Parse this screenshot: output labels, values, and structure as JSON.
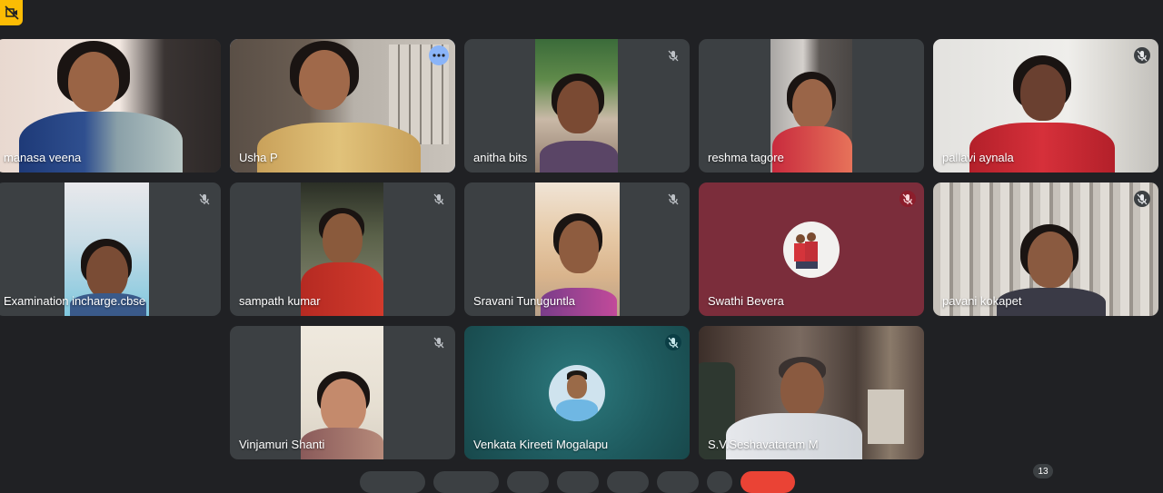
{
  "participants": [
    {
      "name": "manasa veena"
    },
    {
      "name": "Usha P"
    },
    {
      "name": "anitha bits"
    },
    {
      "name": "reshma tagore"
    },
    {
      "name": "pallavi aynala"
    },
    {
      "name": "Examination incharge.cbse"
    },
    {
      "name": "sampath kumar"
    },
    {
      "name": "Sravani Tunuguntla"
    },
    {
      "name": "Swathi Bevera"
    },
    {
      "name": "pavani kokapet"
    },
    {
      "name": "Vinjamuri Shanti"
    },
    {
      "name": "Venkata Kireeti Mogalapu"
    },
    {
      "name": "S.V.Seshavataram M"
    }
  ],
  "participant_count": "13",
  "colors": {
    "background": "#202124",
    "tile": "#3c4043",
    "swathi_tile": "#7b2d3b",
    "venkata_tile": "#1e5a5e",
    "mute_red": "#8c1d2b",
    "mute_teal": "#0b3e45",
    "end_call": "#ea4335",
    "accent": "#8ab4f8",
    "warning": "#fbbc04"
  },
  "icons": [
    "no-camera-icon",
    "mic-off-icon",
    "more-options-icon",
    "avatar-icon"
  ]
}
